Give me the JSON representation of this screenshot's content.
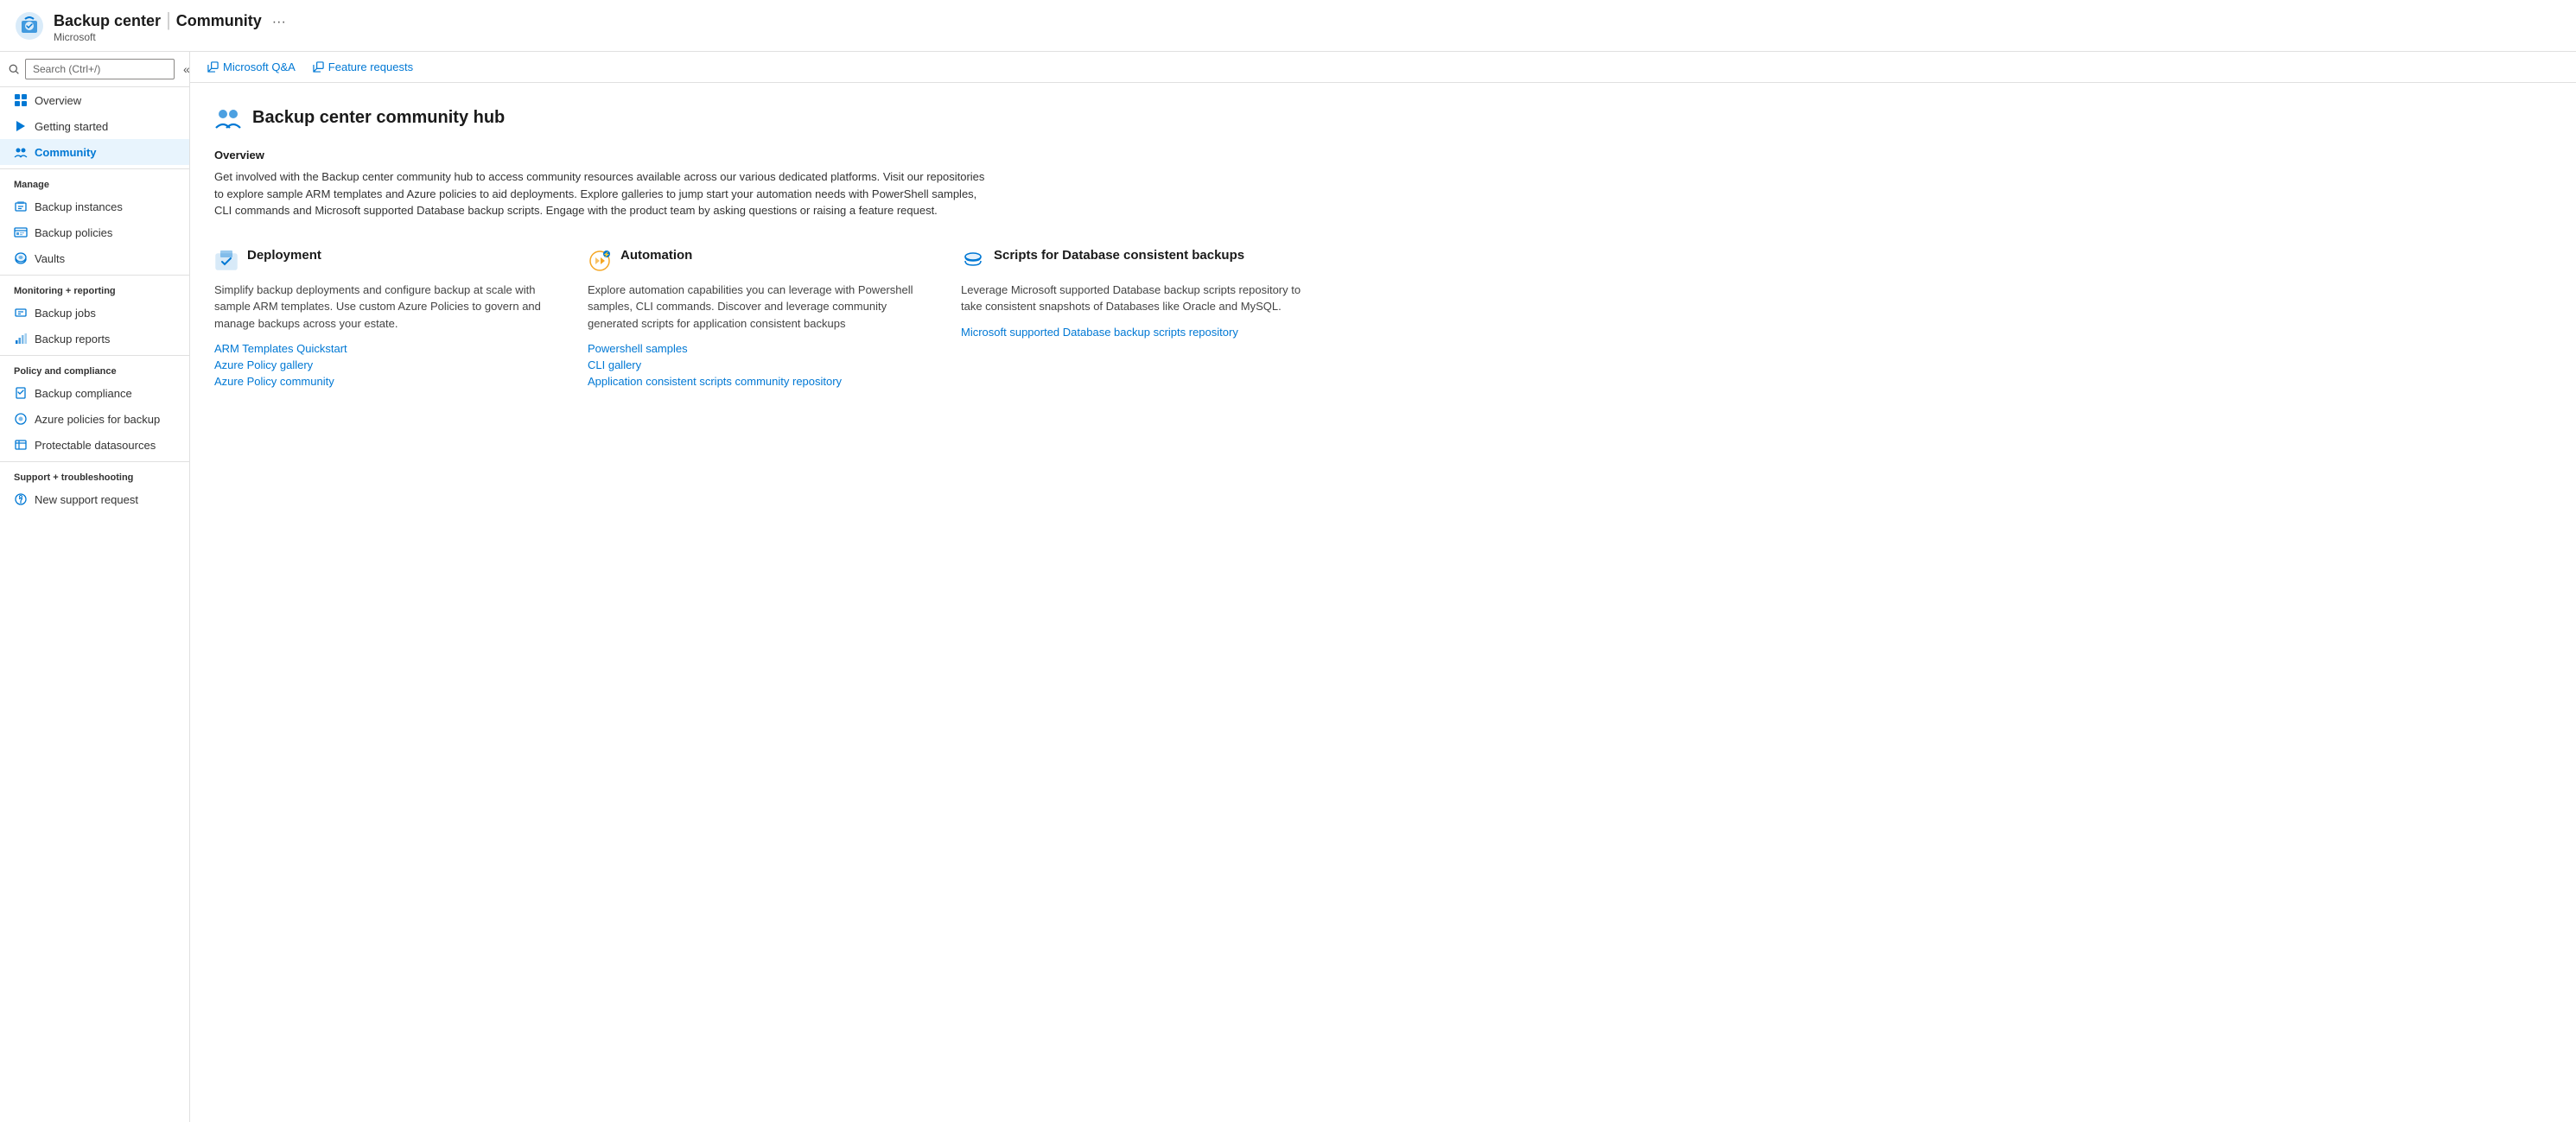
{
  "header": {
    "app_name": "Backup center",
    "separator": "|",
    "page_name": "Community",
    "subtitle": "Microsoft",
    "more_label": "···"
  },
  "search": {
    "placeholder": "Search (Ctrl+/)",
    "collapse_icon": "«"
  },
  "sidebar": {
    "top_items": [
      {
        "id": "overview",
        "label": "Overview",
        "active": false
      },
      {
        "id": "getting-started",
        "label": "Getting started",
        "active": false
      },
      {
        "id": "community",
        "label": "Community",
        "active": true
      }
    ],
    "sections": [
      {
        "label": "Manage",
        "items": [
          {
            "id": "backup-instances",
            "label": "Backup instances"
          },
          {
            "id": "backup-policies",
            "label": "Backup policies"
          },
          {
            "id": "vaults",
            "label": "Vaults"
          }
        ]
      },
      {
        "label": "Monitoring + reporting",
        "items": [
          {
            "id": "backup-jobs",
            "label": "Backup jobs"
          },
          {
            "id": "backup-reports",
            "label": "Backup reports"
          }
        ]
      },
      {
        "label": "Policy and compliance",
        "items": [
          {
            "id": "backup-compliance",
            "label": "Backup compliance"
          },
          {
            "id": "azure-policies",
            "label": "Azure policies for backup"
          },
          {
            "id": "protectable-datasources",
            "label": "Protectable datasources"
          }
        ]
      },
      {
        "label": "Support + troubleshooting",
        "items": [
          {
            "id": "new-support-request",
            "label": "New support request"
          }
        ]
      }
    ]
  },
  "toolbar": {
    "links": [
      {
        "id": "ms-qa",
        "label": "Microsoft Q&A"
      },
      {
        "id": "feature-requests",
        "label": "Feature requests"
      }
    ]
  },
  "main": {
    "hero_title": "Backup center community hub",
    "overview_label": "Overview",
    "overview_text": "Get involved with the Backup center community hub to access community resources available across our various dedicated platforms. Visit our repositories to explore sample ARM templates and Azure policies to aid deployments. Explore galleries to jump start your automation needs with PowerShell samples, CLI commands and Microsoft supported Database backup scripts. Engage with the product team by asking questions or raising a feature request.",
    "cards": [
      {
        "id": "deployment",
        "title": "Deployment",
        "description": "Simplify backup deployments and configure backup at scale with sample ARM templates. Use custom Azure Policies to govern and manage backups across your estate.",
        "links": [
          {
            "id": "arm-quickstart",
            "label": "ARM Templates Quickstart"
          },
          {
            "id": "azure-policy-gallery",
            "label": "Azure Policy gallery"
          },
          {
            "id": "azure-policy-community",
            "label": "Azure Policy community"
          }
        ]
      },
      {
        "id": "automation",
        "title": "Automation",
        "description": "Explore automation capabilities you can leverage with Powershell samples, CLI commands. Discover and leverage community generated scripts for application consistent backups",
        "links": [
          {
            "id": "powershell-samples",
            "label": "Powershell samples"
          },
          {
            "id": "cli-gallery",
            "label": "CLI gallery"
          },
          {
            "id": "app-consistent-scripts",
            "label": "Application consistent scripts community repository"
          }
        ]
      },
      {
        "id": "db-scripts",
        "title": "Scripts for Database consistent backups",
        "description": "Leverage Microsoft supported Database backup scripts repository to take consistent snapshots of Databases like Oracle and MySQL.",
        "links": [
          {
            "id": "ms-db-scripts",
            "label": "Microsoft supported Database backup scripts repository"
          }
        ]
      }
    ]
  }
}
